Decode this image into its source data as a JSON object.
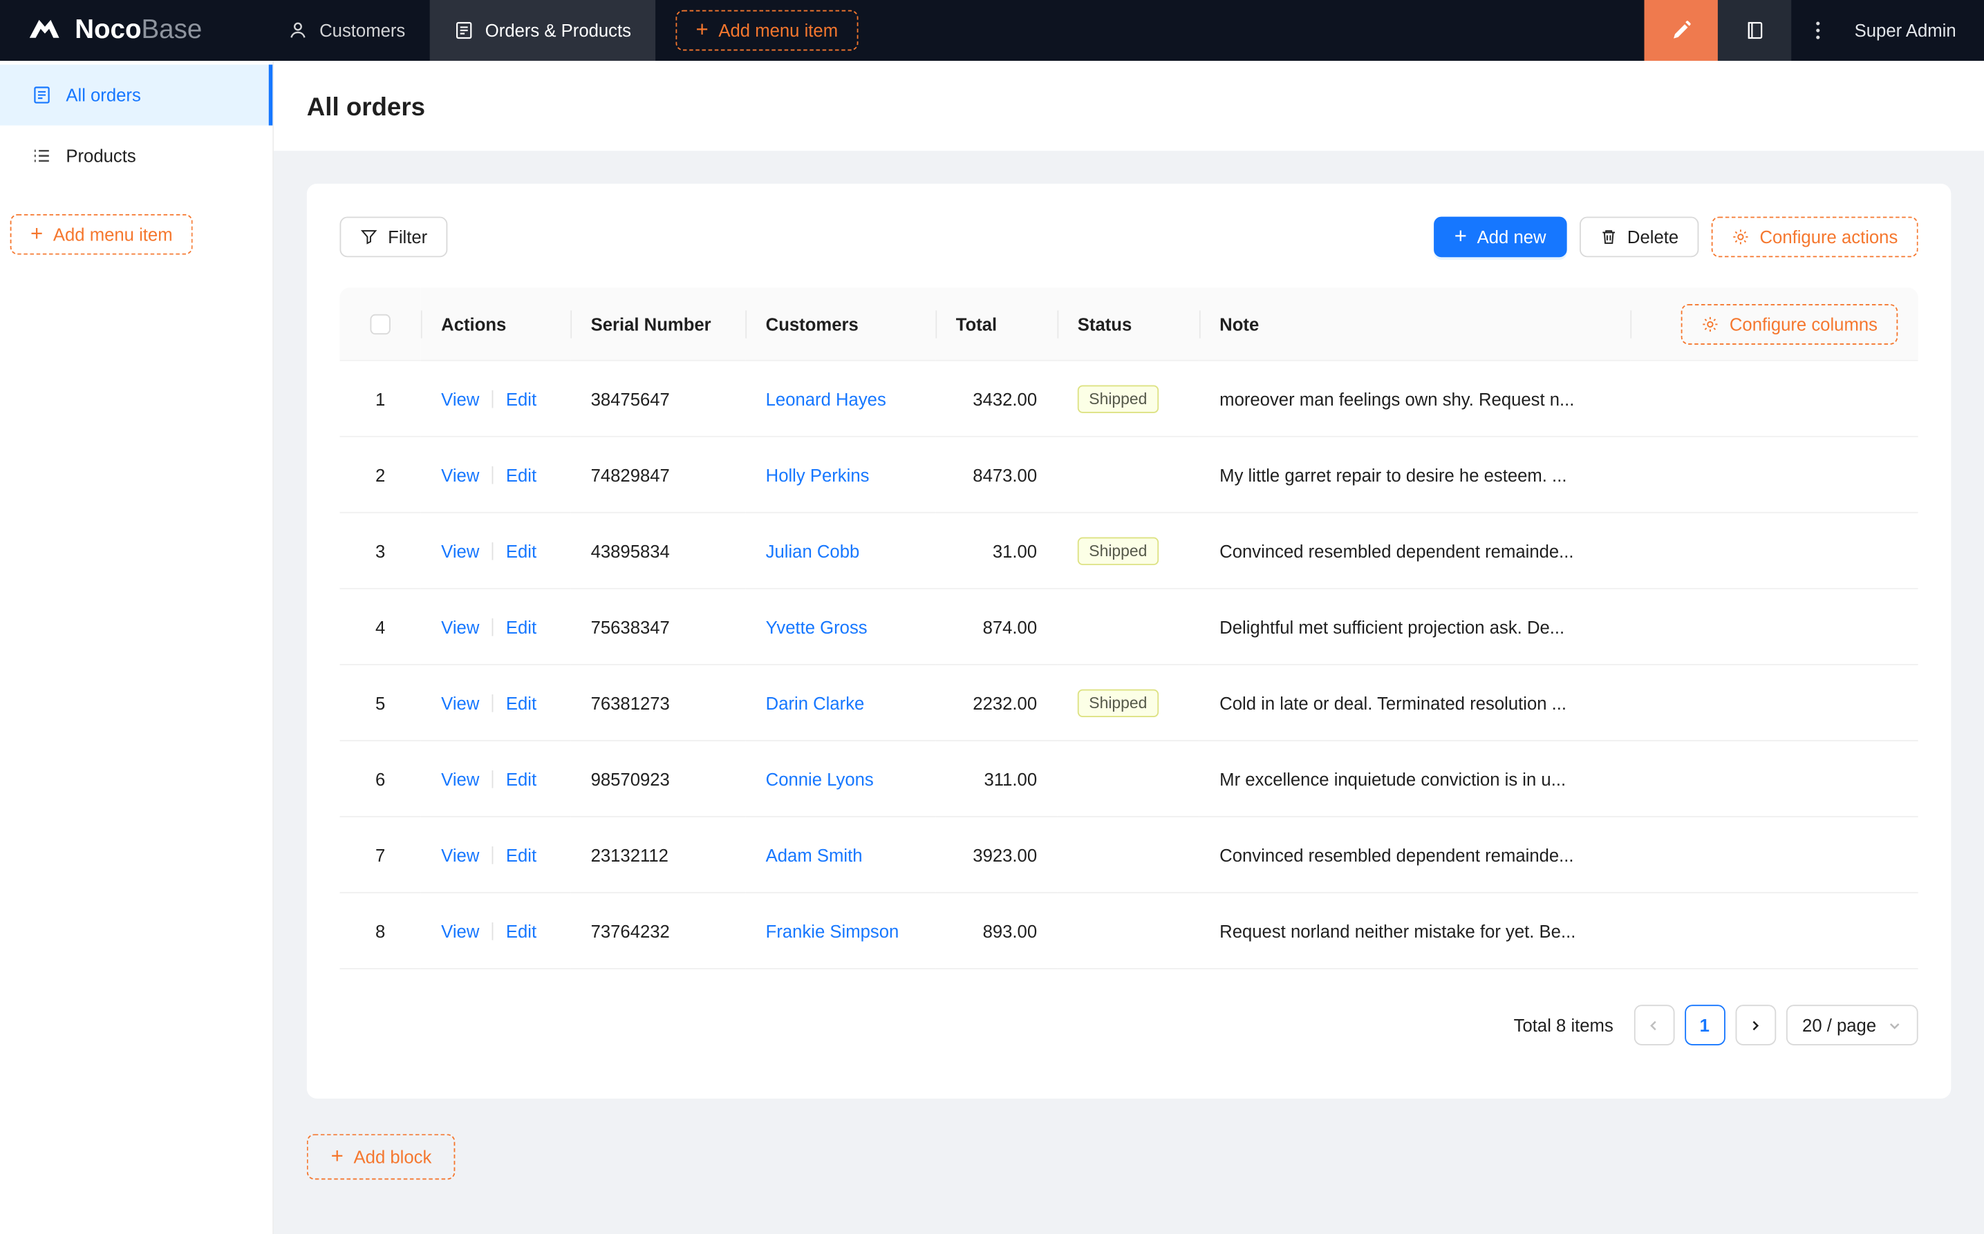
{
  "colors": {
    "primary": "#1677ff",
    "accent_orange": "#f5772e",
    "designer_button": "#ef7a4e",
    "topbar_bg": "#0d1320",
    "sidebar_active_bg": "#e6f4ff",
    "status_shipped_bg": "#fcffe6",
    "status_shipped_border": "#dde283"
  },
  "topbar": {
    "logo_bold": "Noco",
    "logo_light": "Base",
    "nav": [
      {
        "label": "Customers",
        "icon": "customers-icon",
        "active": false
      },
      {
        "label": "Orders & Products",
        "icon": "orders-icon",
        "active": true
      }
    ],
    "add_menu_item_label": "Add menu item",
    "user_name": "Super Admin"
  },
  "sidebar": {
    "items": [
      {
        "label": "All orders",
        "icon": "orders-form-icon",
        "active": true
      },
      {
        "label": "Products",
        "icon": "list-icon",
        "active": false
      }
    ],
    "add_menu_item_label": "Add menu item"
  },
  "page": {
    "title": "All orders"
  },
  "toolbar": {
    "filter_label": "Filter",
    "add_new_label": "Add new",
    "delete_label": "Delete",
    "configure_actions_label": "Configure actions"
  },
  "table": {
    "columns": [
      "",
      "Actions",
      "Serial Number",
      "Customers",
      "Total",
      "Status",
      "Note"
    ],
    "configure_columns_label": "Configure columns",
    "view_label": "View",
    "edit_label": "Edit",
    "rows": [
      {
        "index": 1,
        "serial_number": "38475647",
        "customer": "Leonard Hayes",
        "total": "3432.00",
        "status": "Shipped",
        "note": "moreover man feelings own shy. Request n..."
      },
      {
        "index": 2,
        "serial_number": "74829847",
        "customer": "Holly Perkins",
        "total": "8473.00",
        "status": "",
        "note": "My little garret repair to desire he esteem. ..."
      },
      {
        "index": 3,
        "serial_number": "43895834",
        "customer": "Julian Cobb",
        "total": "31.00",
        "status": "Shipped",
        "note": "Convinced resembled dependent remainde..."
      },
      {
        "index": 4,
        "serial_number": "75638347",
        "customer": "Yvette Gross",
        "total": "874.00",
        "status": "",
        "note": "Delightful met sufficient projection ask. De..."
      },
      {
        "index": 5,
        "serial_number": "76381273",
        "customer": "Darin Clarke",
        "total": "2232.00",
        "status": "Shipped",
        "note": "Cold in late or deal. Terminated resolution ..."
      },
      {
        "index": 6,
        "serial_number": "98570923",
        "customer": "Connie Lyons",
        "total": "311.00",
        "status": "",
        "note": "Mr excellence inquietude conviction is in u..."
      },
      {
        "index": 7,
        "serial_number": "23132112",
        "customer": "Adam Smith",
        "total": "3923.00",
        "status": "",
        "note": "Convinced resembled dependent remainde..."
      },
      {
        "index": 8,
        "serial_number": "73764232",
        "customer": "Frankie Simpson",
        "total": "893.00",
        "status": "",
        "note": "Request norland neither mistake for yet. Be..."
      }
    ]
  },
  "pagination": {
    "total_text": "Total 8 items",
    "current_page": "1",
    "page_size_label": "20 / page"
  },
  "content": {
    "add_block_label": "Add block"
  }
}
